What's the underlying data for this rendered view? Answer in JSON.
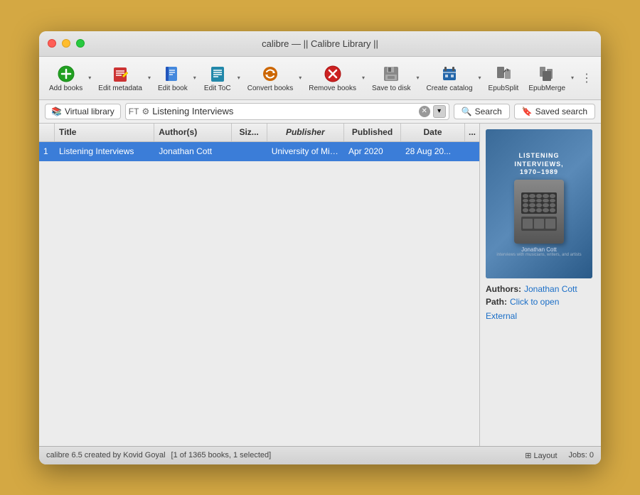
{
  "window": {
    "title": "calibre — || Calibre Library ||"
  },
  "toolbar": {
    "buttons": [
      {
        "id": "add-books",
        "label": "Add books",
        "icon": "➕"
      },
      {
        "id": "edit-metadata",
        "label": "Edit metadata",
        "icon": "✏️"
      },
      {
        "id": "edit-book",
        "label": "Edit book",
        "icon": "📖"
      },
      {
        "id": "edit-toc",
        "label": "Edit ToC",
        "icon": "📋"
      },
      {
        "id": "convert-books",
        "label": "Convert books",
        "icon": "🔄"
      },
      {
        "id": "remove-books",
        "label": "Remove books",
        "icon": "❌"
      },
      {
        "id": "save-to-disk",
        "label": "Save to disk",
        "icon": "💾"
      },
      {
        "id": "create-catalog",
        "label": "Create catalog",
        "icon": "📚"
      },
      {
        "id": "epub-split",
        "label": "EpubSplit",
        "icon": "✂️"
      },
      {
        "id": "epub-merge",
        "label": "EpubMerge",
        "icon": "🔗"
      }
    ]
  },
  "searchbar": {
    "virtual_library": "Virtual library",
    "search_value": "Listening Interviews",
    "search_placeholder": "Search",
    "search_btn": "Search",
    "saved_search_btn": "Saved search"
  },
  "table": {
    "columns": [
      "Title",
      "Author(s)",
      "Siz...",
      "Publisher",
      "Published",
      "Date",
      "..."
    ],
    "rows": [
      {
        "num": "1",
        "title": "Listening Interviews",
        "author": "Jonathan Cott",
        "size": "",
        "publisher": "University of Minn...",
        "published": "Apr 2020",
        "date": "28 Aug 20..."
      }
    ]
  },
  "right_panel": {
    "cover_title": "Listening Interviews, 1970–1989",
    "cover_author": "Jonathan Cott",
    "cover_subtitle": "interviews with musicians, writers, and artists",
    "authors_label": "Authors:",
    "authors_value": "Jonathan Cott",
    "path_label": "Path:",
    "path_value": "Click to open",
    "external_label": "External"
  },
  "statusbar": {
    "app_info": "calibre 6.5 created by Kovid Goyal",
    "book_count": "[1 of 1365 books, 1 selected]",
    "layout_label": "Layout",
    "jobs_label": "Jobs: 0"
  }
}
